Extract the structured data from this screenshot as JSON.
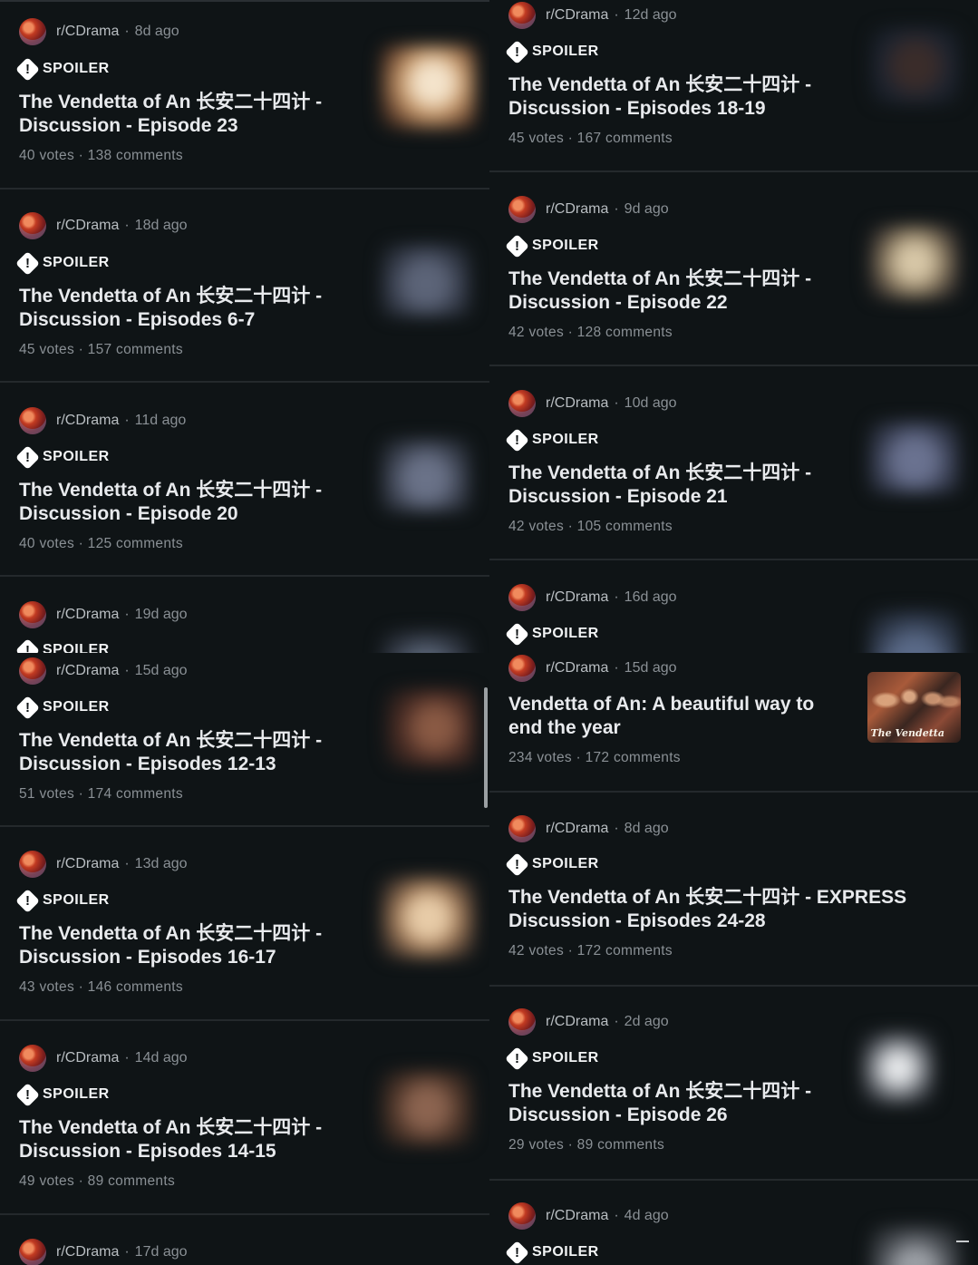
{
  "subreddit": "r/CDrama",
  "spoiler_label": "SPOILER",
  "spoiler_icon": "!",
  "separator": "·",
  "panels": {
    "top_left": [
      {
        "age": "8d ago",
        "title": "The Vendetta of An 长安二十四计 - Discussion - Episode 23",
        "stats": "40 votes · 138 comments"
      },
      {
        "age": "18d ago",
        "title": "The Vendetta of An 长安二十四计 - Discussion - Episodes 6-7",
        "stats": "45 votes · 157 comments"
      },
      {
        "age": "11d ago",
        "title": "The Vendetta of An 长安二十四计 - Discussion - Episode 20",
        "stats": "40 votes · 125 comments"
      },
      {
        "age": "19d ago"
      }
    ],
    "top_right": [
      {
        "age": "12d ago",
        "title": "The Vendetta of An 长安二十四计 - Discussion - Episodes 18-19",
        "stats": "45 votes · 167 comments"
      },
      {
        "age": "9d ago",
        "title": "The Vendetta of An 长安二十四计 - Discussion - Episode 22",
        "stats": "42 votes · 128 comments"
      },
      {
        "age": "10d ago",
        "title": "The Vendetta of An 长安二十四计 - Discussion - Episode 21",
        "stats": "42 votes · 105 comments"
      },
      {
        "age": "16d ago"
      }
    ],
    "bottom_left": [
      {
        "age": "15d ago",
        "title": "The Vendetta of An 长安二十四计 - Discussion - Episodes 12-13",
        "stats": "51 votes · 174 comments"
      },
      {
        "age": "13d ago",
        "title": "The Vendetta of An 长安二十四计 - Discussion - Episodes 16-17",
        "stats": "43 votes · 146 comments"
      },
      {
        "age": "14d ago",
        "title": "The Vendetta of An 长安二十四计 - Discussion - Episodes 14-15",
        "stats": "49 votes · 89 comments"
      },
      {
        "age": "17d ago"
      }
    ],
    "bottom_right": [
      {
        "age": "15d ago",
        "title": "Vendetta of An: A beautiful way to end the year",
        "stats": "234 votes · 172 comments",
        "thumb_text": "The Vendetta"
      },
      {
        "age": "8d ago",
        "title": "The Vendetta of An 长安二十四计 - EXPRESS Discussion - Episodes 24-28",
        "stats": "42 votes · 172 comments"
      },
      {
        "age": "2d ago",
        "title": "The Vendetta of An 长安二十四计 - Discussion - Episode 26",
        "stats": "29 votes · 89 comments"
      },
      {
        "age": "4d ago"
      }
    ]
  }
}
